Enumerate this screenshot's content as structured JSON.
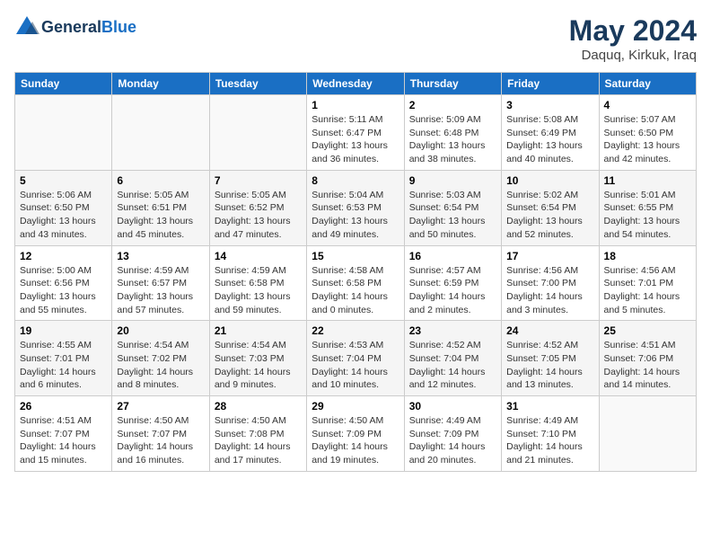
{
  "header": {
    "logo": {
      "general": "General",
      "blue": "Blue"
    },
    "month_year": "May 2024",
    "location": "Daquq, Kirkuk, Iraq"
  },
  "weekdays": [
    "Sunday",
    "Monday",
    "Tuesday",
    "Wednesday",
    "Thursday",
    "Friday",
    "Saturday"
  ],
  "weeks": [
    [
      null,
      null,
      null,
      {
        "day": 1,
        "sunrise": "5:11 AM",
        "sunset": "6:47 PM",
        "daylight": "13 hours and 36 minutes."
      },
      {
        "day": 2,
        "sunrise": "5:09 AM",
        "sunset": "6:48 PM",
        "daylight": "13 hours and 38 minutes."
      },
      {
        "day": 3,
        "sunrise": "5:08 AM",
        "sunset": "6:49 PM",
        "daylight": "13 hours and 40 minutes."
      },
      {
        "day": 4,
        "sunrise": "5:07 AM",
        "sunset": "6:50 PM",
        "daylight": "13 hours and 42 minutes."
      }
    ],
    [
      {
        "day": 5,
        "sunrise": "5:06 AM",
        "sunset": "6:50 PM",
        "daylight": "13 hours and 43 minutes."
      },
      {
        "day": 6,
        "sunrise": "5:05 AM",
        "sunset": "6:51 PM",
        "daylight": "13 hours and 45 minutes."
      },
      {
        "day": 7,
        "sunrise": "5:05 AM",
        "sunset": "6:52 PM",
        "daylight": "13 hours and 47 minutes."
      },
      {
        "day": 8,
        "sunrise": "5:04 AM",
        "sunset": "6:53 PM",
        "daylight": "13 hours and 49 minutes."
      },
      {
        "day": 9,
        "sunrise": "5:03 AM",
        "sunset": "6:54 PM",
        "daylight": "13 hours and 50 minutes."
      },
      {
        "day": 10,
        "sunrise": "5:02 AM",
        "sunset": "6:54 PM",
        "daylight": "13 hours and 52 minutes."
      },
      {
        "day": 11,
        "sunrise": "5:01 AM",
        "sunset": "6:55 PM",
        "daylight": "13 hours and 54 minutes."
      }
    ],
    [
      {
        "day": 12,
        "sunrise": "5:00 AM",
        "sunset": "6:56 PM",
        "daylight": "13 hours and 55 minutes."
      },
      {
        "day": 13,
        "sunrise": "4:59 AM",
        "sunset": "6:57 PM",
        "daylight": "13 hours and 57 minutes."
      },
      {
        "day": 14,
        "sunrise": "4:59 AM",
        "sunset": "6:58 PM",
        "daylight": "13 hours and 59 minutes."
      },
      {
        "day": 15,
        "sunrise": "4:58 AM",
        "sunset": "6:58 PM",
        "daylight": "14 hours and 0 minutes."
      },
      {
        "day": 16,
        "sunrise": "4:57 AM",
        "sunset": "6:59 PM",
        "daylight": "14 hours and 2 minutes."
      },
      {
        "day": 17,
        "sunrise": "4:56 AM",
        "sunset": "7:00 PM",
        "daylight": "14 hours and 3 minutes."
      },
      {
        "day": 18,
        "sunrise": "4:56 AM",
        "sunset": "7:01 PM",
        "daylight": "14 hours and 5 minutes."
      }
    ],
    [
      {
        "day": 19,
        "sunrise": "4:55 AM",
        "sunset": "7:01 PM",
        "daylight": "14 hours and 6 minutes."
      },
      {
        "day": 20,
        "sunrise": "4:54 AM",
        "sunset": "7:02 PM",
        "daylight": "14 hours and 8 minutes."
      },
      {
        "day": 21,
        "sunrise": "4:54 AM",
        "sunset": "7:03 PM",
        "daylight": "14 hours and 9 minutes."
      },
      {
        "day": 22,
        "sunrise": "4:53 AM",
        "sunset": "7:04 PM",
        "daylight": "14 hours and 10 minutes."
      },
      {
        "day": 23,
        "sunrise": "4:52 AM",
        "sunset": "7:04 PM",
        "daylight": "14 hours and 12 minutes."
      },
      {
        "day": 24,
        "sunrise": "4:52 AM",
        "sunset": "7:05 PM",
        "daylight": "14 hours and 13 minutes."
      },
      {
        "day": 25,
        "sunrise": "4:51 AM",
        "sunset": "7:06 PM",
        "daylight": "14 hours and 14 minutes."
      }
    ],
    [
      {
        "day": 26,
        "sunrise": "4:51 AM",
        "sunset": "7:07 PM",
        "daylight": "14 hours and 15 minutes."
      },
      {
        "day": 27,
        "sunrise": "4:50 AM",
        "sunset": "7:07 PM",
        "daylight": "14 hours and 16 minutes."
      },
      {
        "day": 28,
        "sunrise": "4:50 AM",
        "sunset": "7:08 PM",
        "daylight": "14 hours and 17 minutes."
      },
      {
        "day": 29,
        "sunrise": "4:50 AM",
        "sunset": "7:09 PM",
        "daylight": "14 hours and 19 minutes."
      },
      {
        "day": 30,
        "sunrise": "4:49 AM",
        "sunset": "7:09 PM",
        "daylight": "14 hours and 20 minutes."
      },
      {
        "day": 31,
        "sunrise": "4:49 AM",
        "sunset": "7:10 PM",
        "daylight": "14 hours and 21 minutes."
      },
      null
    ]
  ]
}
